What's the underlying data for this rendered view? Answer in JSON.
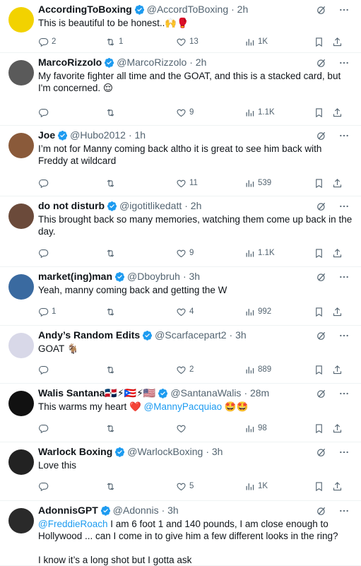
{
  "tweets": [
    {
      "name": "AccordingToBoxing",
      "handle": "@AccordToBoxing",
      "time": "· 2h",
      "text": "This is beautiful to be honest..🙌🥊",
      "replies": "2",
      "retweets": "1",
      "likes": "13",
      "views": "1K",
      "avatar_color": "#f2d200"
    },
    {
      "name": "MarcoRizzolo",
      "handle": "@MarcoRizzolo",
      "time": "· 2h",
      "text": "My favorite fighter all time and the GOAT, and this is a stacked card, but I'm concerned. 😌",
      "replies": "",
      "retweets": "",
      "likes": "9",
      "views": "1.1K",
      "avatar_color": "#5a5a5a"
    },
    {
      "name": "Joe",
      "handle": "@Hubo2012",
      "time": "· 1h",
      "text": "I’m not for Manny coming back altho it is great to see him back with Freddy at wildcard",
      "replies": "",
      "retweets": "",
      "likes": "11",
      "views": "539",
      "avatar_color": "#8a5a3a"
    },
    {
      "name": "do not disturb",
      "handle": "@igotitlikedatt",
      "time": "· 2h",
      "text": "This brought back so many memories, watching them come up back in the day.",
      "replies": "",
      "retweets": "",
      "likes": "9",
      "views": "1.1K",
      "avatar_color": "#6b4a3a"
    },
    {
      "name": "market(ing)man",
      "handle": "@Dboybruh",
      "time": "· 3h",
      "text": "Yeah, manny coming back and getting the W",
      "replies": "1",
      "retweets": "",
      "likes": "4",
      "views": "992",
      "avatar_color": "#3a6aa0"
    },
    {
      "name": "Andy’s Random Edits",
      "handle": "@Scarfacepart2",
      "time": "· 3h",
      "text": "GOAT 🐐",
      "replies": "",
      "retweets": "",
      "likes": "2",
      "views": "889",
      "avatar_color": "#d8d8e8"
    },
    {
      "name": "Walis Santana🇩🇴⚡🇵🇷⚡🇺🇸",
      "handle": "@SantanaWalis",
      "time": "· 28m",
      "text_pre": "This warms my heart ❤️ ",
      "mention": "@MannyPacquiao",
      "text_post": " 🤩🤩",
      "replies": "",
      "retweets": "",
      "likes": "",
      "views": "98",
      "avatar_color": "#111111"
    },
    {
      "name": "Warlock Boxing",
      "handle": "@WarlockBoxing",
      "time": "· 3h",
      "text": "Love this",
      "replies": "",
      "retweets": "",
      "likes": "5",
      "views": "1K",
      "avatar_color": "#222222"
    },
    {
      "name": "AdonnisGPT",
      "handle": "@Adonnis",
      "time": "· 3h",
      "mention": "@FreddieRoach",
      "text_post": " I am 6 foot 1 and 140 pounds, I am close enough to Hollywood ... can I come in to give him a few different looks in the ring?\n\nI know it’s a long shot but I gotta ask",
      "avatar_color": "#2a2a2a"
    }
  ],
  "colors": {
    "accent": "#1d9bf0",
    "muted": "#536471",
    "text": "#0f1419",
    "verified": "#1d9bf0"
  }
}
